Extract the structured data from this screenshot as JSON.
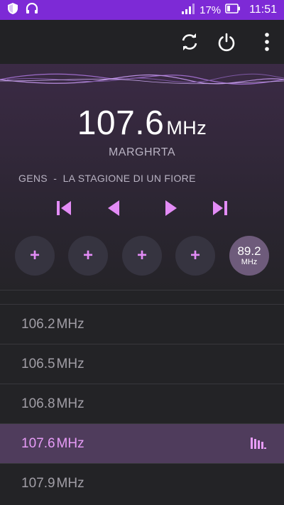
{
  "status_bar": {
    "battery_percent": "17%",
    "time": "11:51",
    "icons": [
      "shield-icon",
      "headset-icon",
      "signal-icon",
      "battery-icon"
    ]
  },
  "toolbar": {
    "icons": [
      "refresh-icon",
      "power-icon",
      "more-vert-icon"
    ]
  },
  "now_playing": {
    "frequency": "107.6",
    "unit": "MHz",
    "station": "MARGHRTA",
    "song": "GENS  -  LA STAGIONE DI UN FIORE"
  },
  "controls": [
    "skip-previous-icon",
    "seek-back-icon",
    "seek-forward-icon",
    "skip-next-icon"
  ],
  "presets": [
    {
      "label": "+"
    },
    {
      "label": "+"
    },
    {
      "label": "+"
    },
    {
      "label": "+"
    },
    {
      "value": "89.2",
      "unit": "MHz"
    }
  ],
  "stations": [
    {
      "frequency": "106.2",
      "unit": "MHz"
    },
    {
      "frequency": "106.5",
      "unit": "MHz"
    },
    {
      "frequency": "106.8",
      "unit": "MHz"
    },
    {
      "frequency": "107.6",
      "unit": "MHz",
      "playing": true
    },
    {
      "frequency": "107.9",
      "unit": "MHz"
    }
  ],
  "colors": {
    "status_bar": "#7d2ad6",
    "accent": "#e38cf6",
    "active_row": "#4f3c5c"
  }
}
